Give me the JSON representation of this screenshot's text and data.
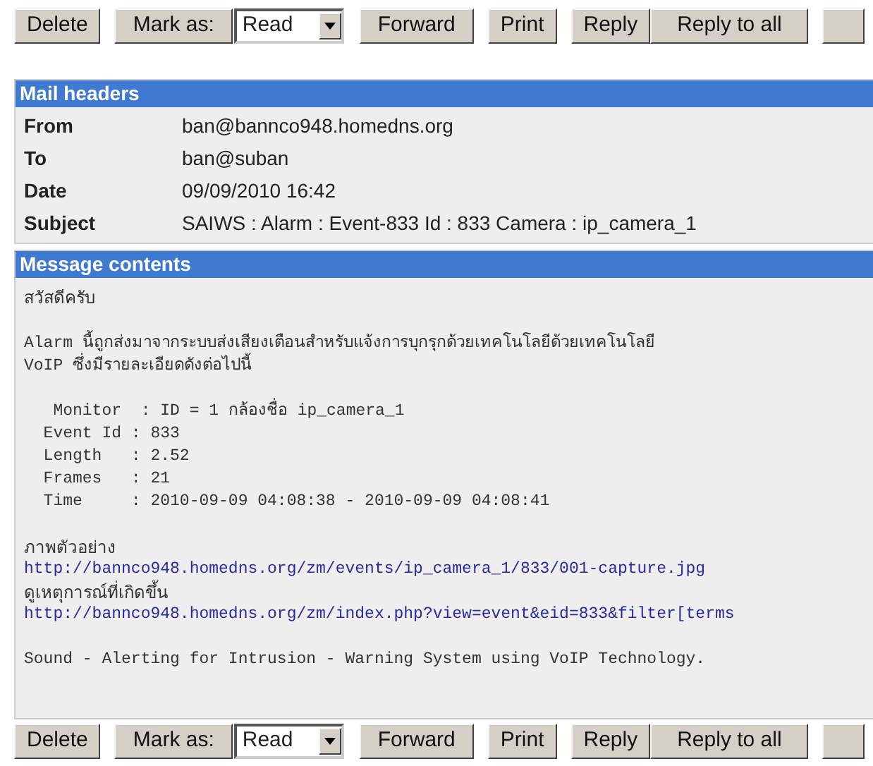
{
  "toolbars": [
    {
      "buttons": [
        "Delete",
        "Mark as:",
        "Forward",
        "Print",
        "Reply",
        "Reply to all"
      ],
      "mark_value": "Read"
    },
    {
      "buttons": [
        "Delete",
        "Mark as:",
        "Forward",
        "Print",
        "Reply",
        "Reply to all"
      ],
      "mark_value": "Read"
    }
  ],
  "mail_headers": {
    "title": "Mail headers",
    "rows": [
      {
        "label": "From",
        "value": "ban@bannco948.homedns.org"
      },
      {
        "label": "To",
        "value": "ban@suban"
      },
      {
        "label": "Date",
        "value": "09/09/2010 16:42"
      },
      {
        "label": "Subject",
        "value": "SAIWS : Alarm : Event-833 Id : 833 Camera : ip_camera_1"
      }
    ]
  },
  "message": {
    "title": "Message contents",
    "blocks": [
      {
        "kind": "text",
        "lines": [
          "สวัสดีครับ"
        ]
      },
      {
        "kind": "pre",
        "lines": [
          "Alarm นี้ถูกส่งมาจากระบบส่งเสียงเตือนสำหรับแจ้งการบุกรุกด้วยเทคโนโลยีด้วยเทคโนโลยี",
          "VoIP ซึ่งมีรายละเอียดดังต่อไปนี้"
        ]
      },
      {
        "kind": "pre",
        "lines": [
          "   Monitor  : ID = 1 กล้องชื่อ ip_camera_1",
          "  Event Id : 833",
          "  Length   : 2.52",
          "  Frames   : 21",
          "  Time     : 2010-09-09 04:08:38 - 2010-09-09 04:08:41"
        ]
      },
      {
        "kind": "links",
        "items": [
          {
            "caption": "ภาพตัวอย่าง",
            "url": "http://bannco948.homedns.org/zm/events/ip_camera_1/833/001-capture.jpg"
          },
          {
            "caption": "ดูเหตุการณ์ที่เกิดขึ้น",
            "url": "http://bannco948.homedns.org/zm/index.php?view=event&eid=833&filter[terms"
          }
        ]
      },
      {
        "kind": "pre",
        "lines": [
          "Sound - Alerting for Intrusion - Warning System using VoIP Technology."
        ]
      }
    ]
  }
}
